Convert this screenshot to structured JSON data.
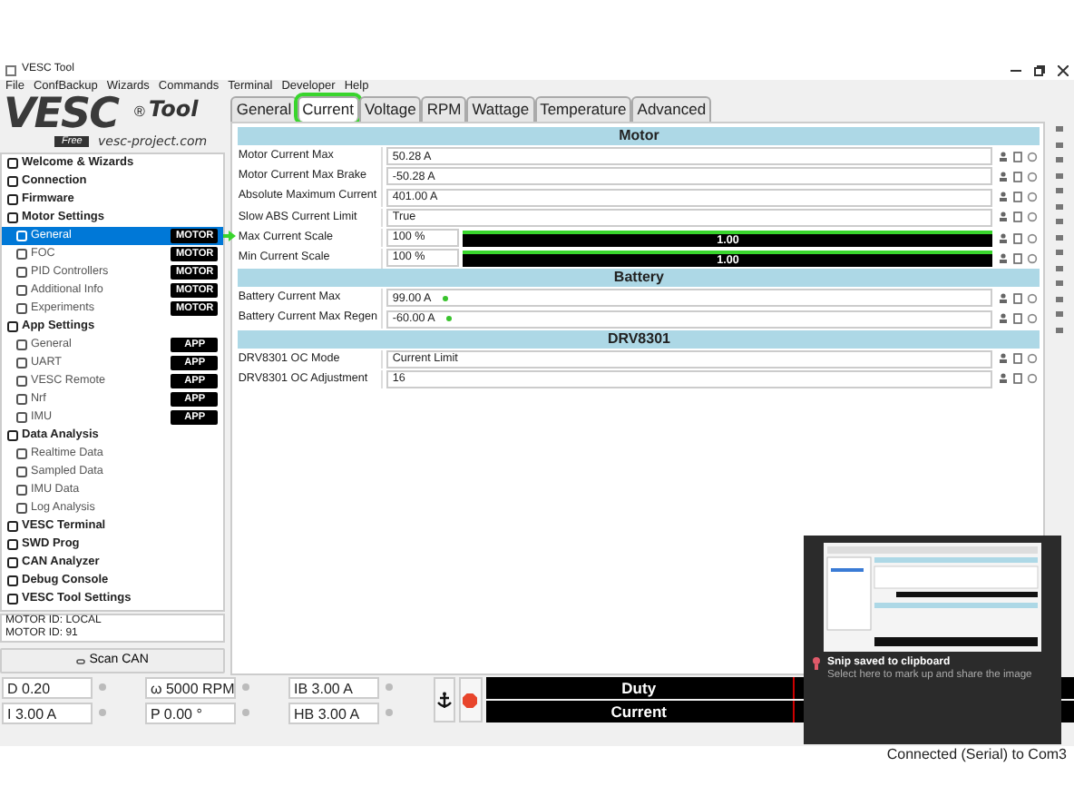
{
  "window": {
    "title": "VESC Tool"
  },
  "menu": [
    "File",
    "ConfBackup",
    "Wizards",
    "Commands",
    "Terminal",
    "Developer",
    "Help"
  ],
  "logo": {
    "wordmark": "VESC",
    "registered": "®",
    "product": "Tool",
    "edition": "Free",
    "url": "vesc-project.com"
  },
  "sidebar": {
    "items": [
      {
        "label": "Welcome & Wizards",
        "selected": false
      },
      {
        "label": "Connection",
        "selected": false
      },
      {
        "label": "Firmware",
        "selected": false
      },
      {
        "label": "Motor Settings",
        "selected": false,
        "children": [
          {
            "label": "General",
            "badge": "MOTOR",
            "selected": true
          },
          {
            "label": "FOC",
            "badge": "MOTOR",
            "selected": false
          },
          {
            "label": "PID Controllers",
            "badge": "MOTOR",
            "selected": false
          },
          {
            "label": "Additional Info",
            "badge": "MOTOR",
            "selected": false
          },
          {
            "label": "Experiments",
            "badge": "MOTOR",
            "selected": false
          }
        ]
      },
      {
        "label": "App Settings",
        "selected": false,
        "children": [
          {
            "label": "General",
            "badge": "APP",
            "selected": false
          },
          {
            "label": "UART",
            "badge": "APP",
            "selected": false
          },
          {
            "label": "VESC Remote",
            "badge": "APP",
            "selected": false
          },
          {
            "label": "Nrf",
            "badge": "APP",
            "selected": false
          },
          {
            "label": "IMU",
            "badge": "APP",
            "selected": false
          }
        ]
      },
      {
        "label": "Data Analysis",
        "selected": false,
        "children": [
          {
            "label": "Realtime Data",
            "selected": false
          },
          {
            "label": "Sampled Data",
            "selected": false
          },
          {
            "label": "IMU Data",
            "selected": false
          },
          {
            "label": "Log Analysis",
            "selected": false
          }
        ]
      },
      {
        "label": "VESC Terminal",
        "selected": false
      },
      {
        "label": "SWD Prog",
        "selected": false
      },
      {
        "label": "CAN Analyzer",
        "selected": false
      },
      {
        "label": "Debug Console",
        "selected": false
      },
      {
        "label": "VESC Tool Settings",
        "selected": false
      }
    ],
    "motor_ids": [
      "MOTOR ID: LOCAL",
      "MOTOR ID: 91"
    ],
    "scan_button": "Scan CAN"
  },
  "tabs": [
    {
      "label": "General",
      "selected": false,
      "highlighted": false
    },
    {
      "label": "Current",
      "selected": true,
      "highlighted": true
    },
    {
      "label": "Voltage",
      "selected": false,
      "highlighted": false
    },
    {
      "label": "RPM",
      "selected": false,
      "highlighted": false
    },
    {
      "label": "Wattage",
      "selected": false,
      "highlighted": false
    },
    {
      "label": "Temperature",
      "selected": false,
      "highlighted": false
    },
    {
      "label": "Advanced",
      "selected": false,
      "highlighted": false
    }
  ],
  "sections": [
    {
      "title": "Motor",
      "rows": [
        {
          "kind": "spin",
          "label": "Motor Current Max",
          "value": "50.28 A",
          "modified": false
        },
        {
          "kind": "spin",
          "label": "Motor Current Max Brake",
          "value": "-50.28 A",
          "modified": false
        },
        {
          "kind": "spin",
          "label": "Absolute Maximum Current",
          "value": "401.00 A",
          "modified": false
        },
        {
          "kind": "combo",
          "label": "Slow ABS Current Limit",
          "value": "True",
          "modified": false
        },
        {
          "kind": "bar",
          "label": "Max Current Scale",
          "value": "100 %",
          "level": 1,
          "reading": "1.00",
          "highlighted": true,
          "modified": false
        },
        {
          "kind": "bar",
          "label": "Min Current Scale",
          "value": "100 %",
          "level": 1,
          "reading": "1.00",
          "highlighted": true,
          "modified": false
        }
      ]
    },
    {
      "title": "Battery",
      "rows": [
        {
          "kind": "spin",
          "label": "Battery Current Max",
          "value": "99.00 A",
          "modified": true
        },
        {
          "kind": "spin",
          "label": "Battery Current Max Regen",
          "value": "-60.00 A",
          "modified": true
        }
      ]
    },
    {
      "title": "DRV8301",
      "rows": [
        {
          "kind": "combo",
          "label": "DRV8301 OC Mode",
          "value": "Current Limit",
          "modified": false
        },
        {
          "kind": "spin",
          "label": "DRV8301 OC Adjustment",
          "value": "16",
          "modified": false
        }
      ]
    }
  ],
  "annotations": [
    {
      "kind": "arrow"
    }
  ],
  "controls": [
    {
      "value": "D 0.20"
    },
    {
      "value": "ω 5000 RPM"
    },
    {
      "value": "IB 3.00 A"
    },
    {
      "value": "I 3.00 A"
    },
    {
      "value": "P 0.00 °"
    },
    {
      "value": "HB 3.00 A"
    }
  ],
  "gauges": [
    {
      "label": "Duty"
    },
    {
      "label": "Current"
    }
  ],
  "status_bar": "Connected (Serial) to Com3",
  "toast": {
    "title": "Snip saved to clipboard",
    "body": "Select here to mark up and share the image"
  }
}
